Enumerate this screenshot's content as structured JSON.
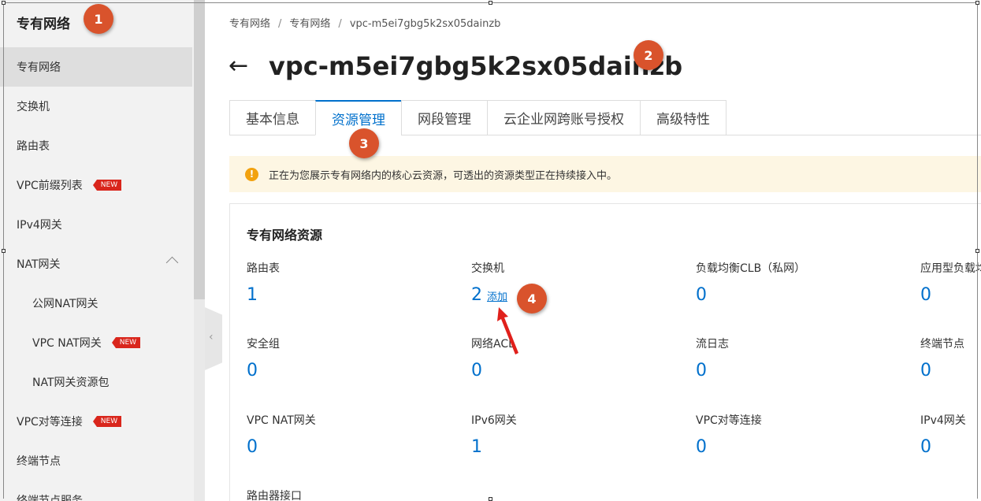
{
  "sidebar": {
    "title": "专有网络",
    "items": [
      {
        "label": "专有网络",
        "badge": ""
      },
      {
        "label": "交换机",
        "badge": ""
      },
      {
        "label": "路由表",
        "badge": ""
      },
      {
        "label": "VPC前缀列表",
        "badge": "NEW"
      },
      {
        "label": "IPv4网关",
        "badge": ""
      },
      {
        "label": "NAT网关",
        "badge": ""
      },
      {
        "label": "公网NAT网关",
        "badge": ""
      },
      {
        "label": "VPC NAT网关",
        "badge": "NEW"
      },
      {
        "label": "NAT网关资源包",
        "badge": ""
      },
      {
        "label": "VPC对等连接",
        "badge": "NEW"
      },
      {
        "label": "终端节点",
        "badge": ""
      },
      {
        "label": "终端节点服务",
        "badge": ""
      }
    ],
    "collapse_glyph": "‹"
  },
  "breadcrumb": [
    "专有网络",
    "专有网络",
    "vpc-m5ei7gbg5k2sx05dainzb"
  ],
  "breadcrumb_sep": "/",
  "back_glyph": "←",
  "page_title": "vpc-m5ei7gbg5k2sx05dainzb",
  "tabs": [
    "基本信息",
    "资源管理",
    "网段管理",
    "云企业网跨账号授权",
    "高级特性"
  ],
  "notice": {
    "icon": "!",
    "text": "正在为您展示专有网络内的核心云资源，可透出的资源类型正在持续接入中。"
  },
  "resources": {
    "title": "专有网络资源",
    "add_label": "添加",
    "items": [
      {
        "label": "路由表",
        "value": "1"
      },
      {
        "label": "交换机",
        "value": "2"
      },
      {
        "label": "负载均衡CLB（私网）",
        "value": "0"
      },
      {
        "label": "应用型负载均衡",
        "value": "0"
      },
      {
        "label": "安全组",
        "value": "0"
      },
      {
        "label": "网络ACL",
        "value": "0"
      },
      {
        "label": "流日志",
        "value": "0"
      },
      {
        "label": "终端节点",
        "value": "0"
      },
      {
        "label": "VPC NAT网关",
        "value": "0"
      },
      {
        "label": "IPv6网关",
        "value": "1"
      },
      {
        "label": "VPC对等连接",
        "value": "0"
      },
      {
        "label": "IPv4网关",
        "value": "0"
      },
      {
        "label": "路由器接口",
        "value": ""
      }
    ]
  },
  "markers": [
    "1",
    "2",
    "3",
    "4"
  ],
  "colors": {
    "accent": "#0070cc",
    "marker": "#d9532c",
    "badge": "#d9261c",
    "notice_bg": "#fdf6e3"
  }
}
